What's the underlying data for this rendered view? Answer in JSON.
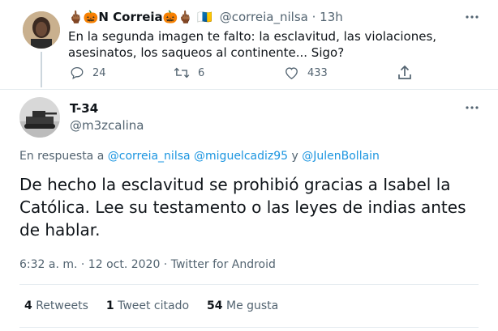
{
  "reply_tweet": {
    "display_name": "🖕🏾🎃N Correia🎃🖕🏾 🇮🇨",
    "handle": "@correia_nilsa",
    "separator": "·",
    "time": "13h",
    "text": "En la segunda imagen te falto: la esclavitud, las violaciones, asesinatos, los saqueos al continente... Sigo?",
    "actions": {
      "reply_count": "24",
      "retweet_count": "6",
      "like_count": "433"
    }
  },
  "main_tweet": {
    "display_name": "T-34",
    "handle": "@m3zcalina",
    "in_reply_prefix": "En respuesta a",
    "mention_1": "@correia_nilsa",
    "mention_2": "@miguelcadiz95",
    "mention_conj": "y",
    "mention_3": "@JulenBollain",
    "text": "De hecho la esclavitud se prohibió gracias a Isabel la Católica. Lee su testamento o las leyes de indias antes de hablar.",
    "timestamp": "6:32 a. m. · 12 oct. 2020 · Twitter for Android",
    "stats": {
      "retweets_count": "4",
      "retweets_label": "Retweets",
      "quotes_count": "1",
      "quotes_label": "Tweet citado",
      "likes_count": "54",
      "likes_label": "Me gusta"
    }
  },
  "icons": {
    "more": "more-horizontal-icon",
    "reply": "reply-icon",
    "retweet": "retweet-icon",
    "like": "heart-icon",
    "share": "share-icon"
  },
  "colors": {
    "link": "#1b95e0",
    "muted": "#536471",
    "divider": "#e6ecf0"
  }
}
